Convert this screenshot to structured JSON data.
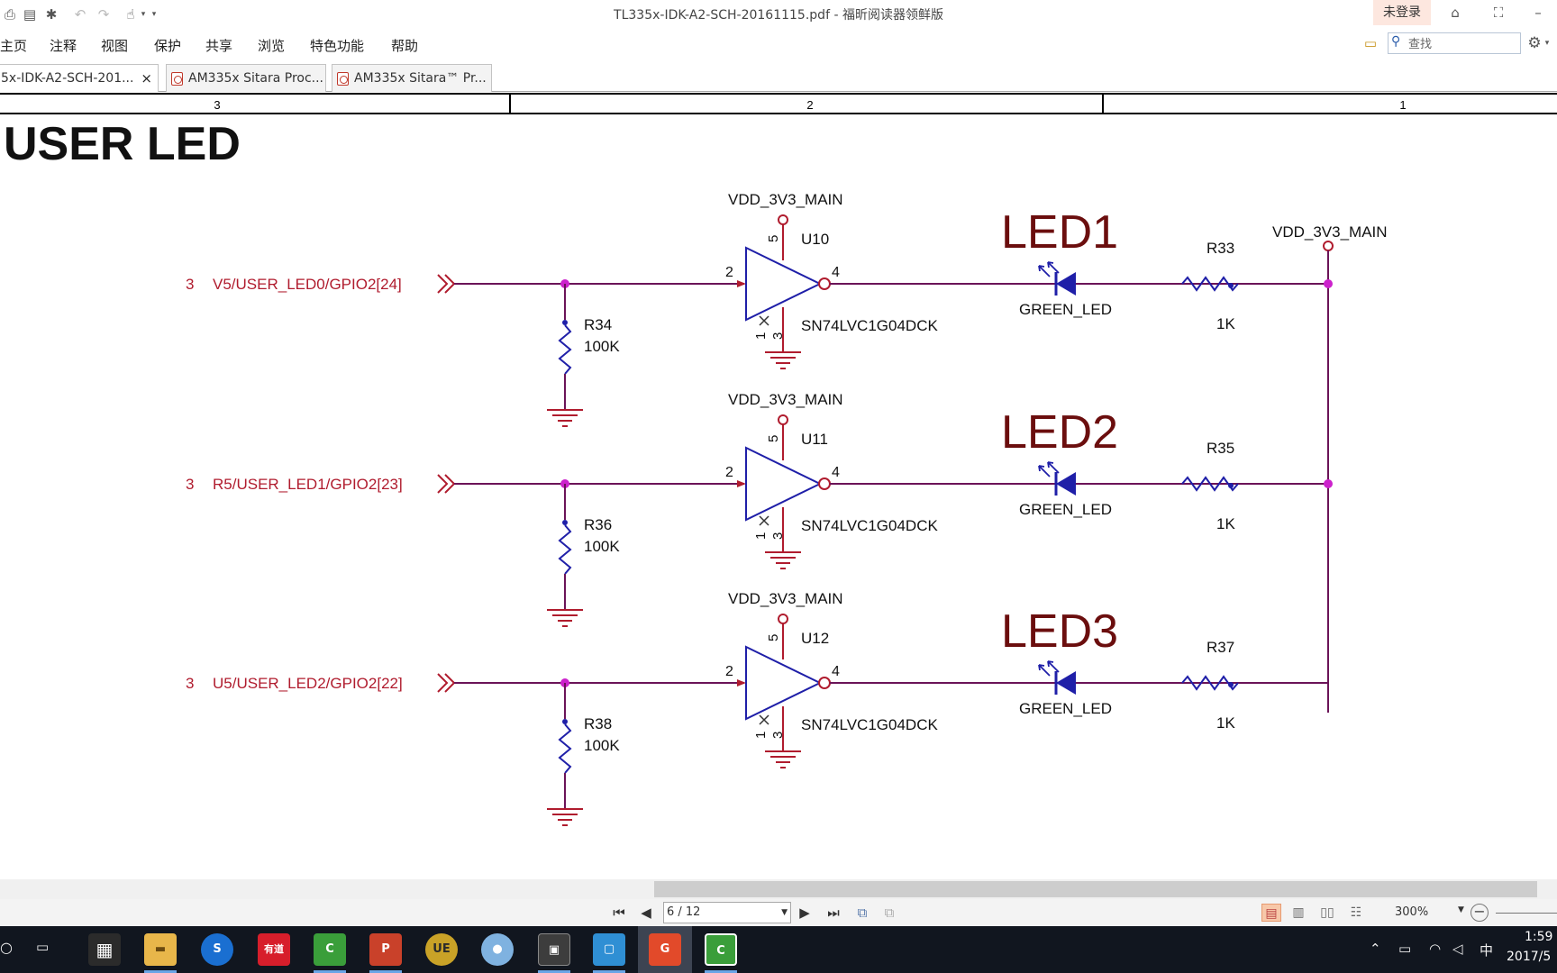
{
  "window": {
    "title": "TL335x-IDK-A2-SCH-20161115.pdf - 福昕阅读器领鲜版",
    "login_label": "未登录"
  },
  "menu": [
    "主页",
    "注释",
    "视图",
    "保护",
    "共享",
    "浏览",
    "特色功能",
    "帮助"
  ],
  "search": {
    "placeholder": "查找"
  },
  "tabs": [
    {
      "label": "5x-IDK-A2-SCH-201...",
      "active": true
    },
    {
      "label": "AM335x Sitara Proc...",
      "active": false
    },
    {
      "label": "AM335x Sitara™ Pr...",
      "active": false
    }
  ],
  "tab_close_glyph": "×",
  "schematic": {
    "zone_labels": [
      "3",
      "2",
      "1"
    ],
    "heading": "USER LED",
    "rails": [
      "VDD_3V3_MAIN",
      "VDD_3V3_MAIN",
      "VDD_3V3_MAIN",
      "VDD_3V3_MAIN"
    ],
    "channels": [
      {
        "sheet_ref": "3",
        "net": "V5/USER_LED0/GPIO2[24]",
        "pd_ref": "R34",
        "pd_val": "100K",
        "gate_ref": "U10",
        "gate_part": "SN74LVC1G04DCK",
        "led_title": "LED1",
        "led_name": "GREEN_LED",
        "r_ref": "R33",
        "r_val": "1K"
      },
      {
        "sheet_ref": "3",
        "net": "R5/USER_LED1/GPIO2[23]",
        "pd_ref": "R36",
        "pd_val": "100K",
        "gate_ref": "U11",
        "gate_part": "SN74LVC1G04DCK",
        "led_title": "LED2",
        "led_name": "GREEN_LED",
        "r_ref": "R35",
        "r_val": "1K"
      },
      {
        "sheet_ref": "3",
        "net": "U5/USER_LED2/GPIO2[22]",
        "pd_ref": "R38",
        "pd_val": "100K",
        "gate_ref": "U12",
        "gate_part": "SN74LVC1G04DCK",
        "led_title": "LED3",
        "led_name": "GREEN_LED",
        "r_ref": "R37",
        "r_val": "1K"
      }
    ],
    "pin_numbers": {
      "vcc": "5",
      "input": "2",
      "output": "4",
      "nc": "1",
      "gnd": "3"
    },
    "colors": {
      "net": "#b01c2e",
      "wire": "#6b1458",
      "part": "#1f1fa8",
      "title": "#6b0e0e",
      "junction": "#cc22cc",
      "text": "#111111"
    }
  },
  "status": {
    "page": "6 / 12",
    "zoom": "300%"
  },
  "taskbar": {
    "apps": [
      "file-explorer",
      "sogou",
      "youdao",
      "camtasia",
      "powerpoint",
      "ultraedit",
      "browser",
      "cmd",
      "windows-explorer",
      "foxit",
      "camtasia-recorder"
    ],
    "youdao_label": "有道",
    "ime": "中",
    "time": "1:59",
    "date": "2017/5"
  }
}
